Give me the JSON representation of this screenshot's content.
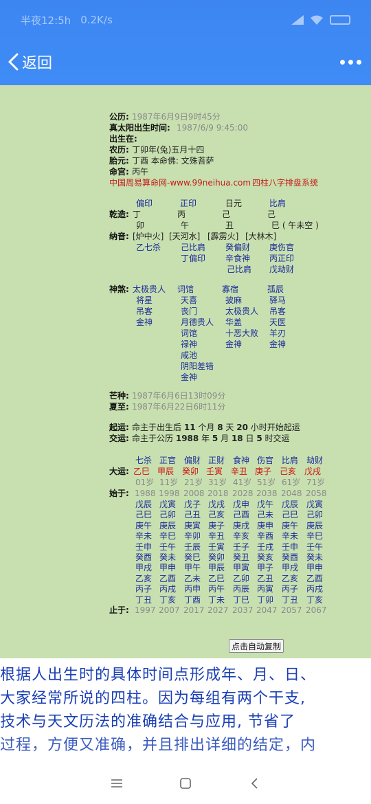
{
  "status_bar": {
    "carrier": "半夜12:5h",
    "speed": "0.2K/s"
  },
  "app_bar": {
    "back_label": "返回"
  },
  "info": {
    "gongli_label": "公历:",
    "gongli_val": "1987年6月9日9时45分",
    "zhentaiyang_label": "真太阳出生时间:",
    "zhentaiyang_val": "1987/6/9 9:45:00",
    "chusheng_label": "出生在:",
    "nongli_label": "农历:",
    "nongli_val": "丁卯年(兔)五月十四",
    "taiyuan_label": "胎元:",
    "taiyuan_val": "丁酉  本命佛: 文殊菩萨",
    "minggong_label": "命宫:",
    "minggong_val": "丙午",
    "site": "中国周易算命网-www.99neihua.com",
    "system": "四柱八字排盘系统"
  },
  "pillars": {
    "shishen": [
      "偏印",
      "正印",
      "日元",
      "比肩"
    ],
    "qianzao_label": "乾造:",
    "gan": [
      "丁",
      "丙",
      "己",
      "己"
    ],
    "zhi": [
      "卯",
      "午",
      "丑",
      "巳 ( 午未空 )"
    ],
    "nayin_label": "纳音:",
    "nayin": [
      "[炉中火]",
      "[天河水]",
      "[霹雳火]",
      "[大林木]"
    ],
    "canggan_col1": [
      "乙七杀"
    ],
    "canggan_col2": [
      "己比肩",
      "丁偏印"
    ],
    "canggan_col3": [
      "癸偏财",
      "辛食神",
      "己比肩"
    ],
    "canggan_col4": [
      "庚伤官",
      "丙正印",
      "戊劫财"
    ]
  },
  "shensha": {
    "label": "神煞:",
    "col1": [
      "太极贵人",
      "将星",
      "吊客",
      "金神"
    ],
    "col2": [
      "词馆",
      "天喜",
      "丧门",
      "月德贵人",
      "词馆",
      "禄神",
      "咸池",
      "阴阳差错",
      "金神"
    ],
    "col3": [
      "寡宿",
      "披麻",
      "太极贵人",
      "华盖",
      "十恶大败",
      "金神"
    ],
    "col4": [
      "孤辰",
      "驿马",
      "吊客",
      "天医",
      "羊刃",
      "金神"
    ]
  },
  "jieqi": {
    "mangzhong_label": "芒种:",
    "mangzhong_val": "1987年6月6日13时09分",
    "xiazhi_label": "夏至:",
    "xiazhi_val": "1987年6月22日6时11分"
  },
  "yun": {
    "qiyun_label": "起运:",
    "qiyun_pre": "命主于出生后",
    "qiyun_m": "11",
    "qiyun_m_unit": "个月",
    "qiyun_d": "8",
    "qiyun_d_unit": "天",
    "qiyun_h": "20",
    "qiyun_tail": "小时开始起运",
    "jiaoyun_label": "交运:",
    "jiaoyun_pre": "命主于公历",
    "jiaoyun_y": "1988",
    "jiaoyun_y_unit": "年",
    "jiaoyun_mo": "5",
    "jiaoyun_mo_unit": "月",
    "jiaoyun_d": "18",
    "jiaoyun_d_unit": "日",
    "jiaoyun_h": "5",
    "jiaoyun_tail": "时交运"
  },
  "dayun": {
    "label": "大运:",
    "shishen": [
      "七杀",
      "正官",
      "偏财",
      "正财",
      "食神",
      "伤官",
      "比肩",
      "劫财"
    ],
    "ganzhi": [
      "乙巳",
      "甲辰",
      "癸卯",
      "壬寅",
      "辛丑",
      "庚子",
      "己亥",
      "戊戌"
    ],
    "ages": [
      "01岁",
      "11岁",
      "21岁",
      "31岁",
      "41岁",
      "51岁",
      "61岁",
      "71岁"
    ],
    "shiyu_label": "始于:",
    "start_years": [
      "1988",
      "1998",
      "2008",
      "2018",
      "2028",
      "2038",
      "2048",
      "2058"
    ],
    "liunian": [
      [
        "戊辰",
        "戊寅",
        "戊子",
        "戊戌",
        "戊申",
        "戊午",
        "戊辰",
        "戊寅"
      ],
      [
        "己巳",
        "己卯",
        "己丑",
        "己亥",
        "己酉",
        "己未",
        "己巳",
        "己卯"
      ],
      [
        "庚午",
        "庚辰",
        "庚寅",
        "庚子",
        "庚戌",
        "庚申",
        "庚午",
        "庚辰"
      ],
      [
        "辛未",
        "辛巳",
        "辛卯",
        "辛丑",
        "辛亥",
        "辛酉",
        "辛未",
        "辛巳"
      ],
      [
        "壬申",
        "壬午",
        "壬辰",
        "壬寅",
        "壬子",
        "壬戌",
        "壬申",
        "壬午"
      ],
      [
        "癸酉",
        "癸未",
        "癸巳",
        "癸卯",
        "癸丑",
        "癸亥",
        "癸酉",
        "癸未"
      ],
      [
        "甲戌",
        "甲申",
        "甲午",
        "甲辰",
        "甲寅",
        "甲子",
        "甲戌",
        "甲申"
      ],
      [
        "乙亥",
        "乙酉",
        "乙未",
        "乙巳",
        "乙卯",
        "乙丑",
        "乙亥",
        "乙酉"
      ],
      [
        "丙子",
        "丙戌",
        "丙申",
        "丙午",
        "丙辰",
        "丙寅",
        "丙子",
        "丙戌"
      ],
      [
        "丁丑",
        "丁亥",
        "丁酉",
        "丁未",
        "丁巳",
        "丁卯",
        "丁丑",
        "丁亥"
      ]
    ],
    "zhiyu_label": "止于:",
    "end_years": [
      "1997",
      "2007",
      "2017",
      "2027",
      "2037",
      "2047",
      "2057",
      "2067"
    ]
  },
  "copy_button": "点击自动复制",
  "paragraph": [
    "根据人出生时的具体时间点形成年、月、日、",
    "大家经常所说的四柱。因为每组有两个干支,",
    " 技术与天文历法的准确结合与应用, 节省了",
    "过程，方便又准确，并且排出详细的结定，内"
  ]
}
